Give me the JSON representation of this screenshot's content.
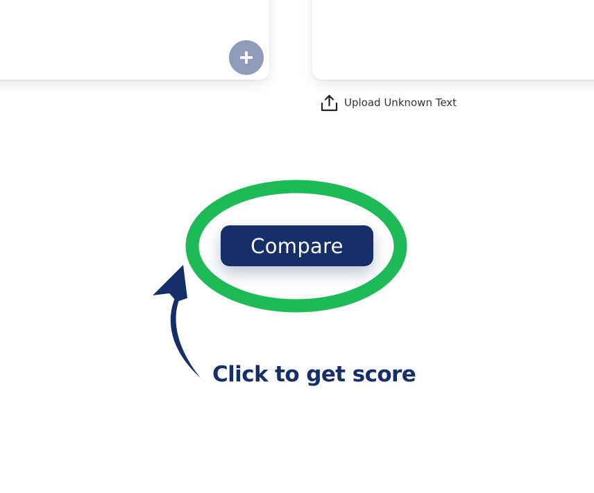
{
  "known_text_panel": {
    "add_button_icon": "plus-icon"
  },
  "unknown_text_panel": {
    "upload_label": "Upload Unknown Text",
    "upload_icon": "upload-icon"
  },
  "compare": {
    "button_label": "Compare",
    "highlight_color": "#1fba58",
    "button_color": "#172f68"
  },
  "annotation": {
    "hint_text": "Click to get score",
    "arrow_icon": "curved-arrow-icon",
    "color": "#172f68"
  }
}
